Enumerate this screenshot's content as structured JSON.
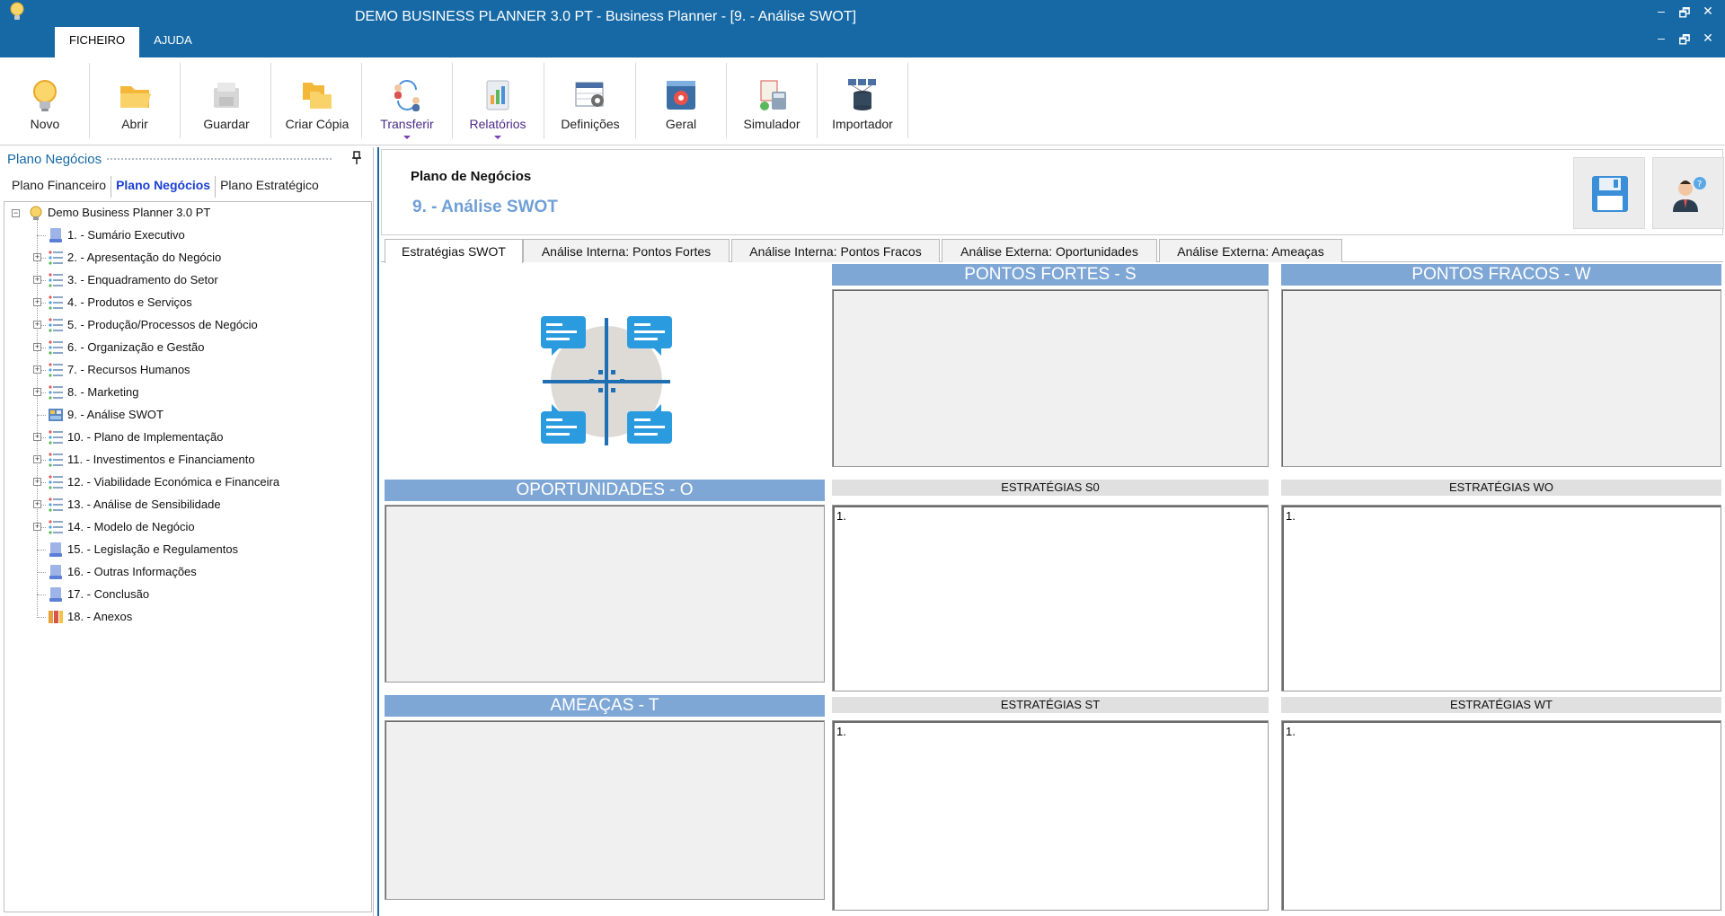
{
  "window": {
    "title": "DEMO BUSINESS PLANNER 3.0 PT - Business Planner - [9. - Análise SWOT]",
    "controls": {
      "minimize": "–",
      "restore": "🗗",
      "close": "✕"
    }
  },
  "menu": {
    "tabs": [
      "FICHEIRO",
      "AJUDA"
    ],
    "active": "FICHEIRO"
  },
  "ribbon": {
    "buttons": [
      {
        "label": "Novo",
        "icon": "lightbulb-icon"
      },
      {
        "label": "Abrir",
        "icon": "folder-open-icon"
      },
      {
        "label": "Guardar",
        "icon": "save-disabled-icon"
      },
      {
        "label": "Criar Cópia",
        "icon": "copy-folder-icon"
      },
      {
        "label": "Transferir",
        "icon": "transfer-people-icon",
        "dropdown": true
      },
      {
        "label": "Relatórios",
        "icon": "reports-chart-icon",
        "dropdown": true
      },
      {
        "label": "Definições",
        "icon": "settings-table-icon"
      },
      {
        "label": "Geral",
        "icon": "general-gear-icon"
      },
      {
        "label": "Simulador",
        "icon": "simulator-calculator-icon"
      },
      {
        "label": "Importador",
        "icon": "importer-database-icon"
      }
    ]
  },
  "left_panel": {
    "title": "Plano Negócios",
    "tabs": [
      "Plano Financeiro",
      "Plano Negócios",
      "Plano Estratégico"
    ],
    "active_tab": "Plano Negócios",
    "tree": {
      "root": "Demo Business Planner 3.0 PT",
      "items": [
        {
          "label": "1. - Sumário Executivo",
          "expandable": false,
          "icon": "page-icon"
        },
        {
          "label": "2. - Apresentação do Negócio",
          "expandable": true,
          "icon": "list-icon"
        },
        {
          "label": "3. - Enquadramento do Setor",
          "expandable": true,
          "icon": "list-icon"
        },
        {
          "label": "4. - Produtos e Serviços",
          "expandable": true,
          "icon": "list-icon"
        },
        {
          "label": "5. - Produção/Processos de Negócio",
          "expandable": true,
          "icon": "list-icon"
        },
        {
          "label": "6. - Organização e Gestão",
          "expandable": true,
          "icon": "list-icon"
        },
        {
          "label": "7. - Recursos Humanos",
          "expandable": true,
          "icon": "list-icon"
        },
        {
          "label": "8. - Marketing",
          "expandable": true,
          "icon": "list-icon"
        },
        {
          "label": "9. - Análise SWOT",
          "expandable": false,
          "icon": "swot-icon"
        },
        {
          "label": "10. - Plano de Implementação",
          "expandable": true,
          "icon": "list-icon"
        },
        {
          "label": "11. - Investimentos e Financiamento",
          "expandable": true,
          "icon": "list-icon"
        },
        {
          "label": "12. - Viabilidade Económica e Financeira",
          "expandable": true,
          "icon": "list-icon"
        },
        {
          "label": "13. - Análise de Sensibilidade",
          "expandable": true,
          "icon": "list-icon"
        },
        {
          "label": "14. - Modelo de Negócio",
          "expandable": true,
          "icon": "list-icon"
        },
        {
          "label": "15. - Legislação e Regulamentos",
          "expandable": false,
          "icon": "page-icon"
        },
        {
          "label": "16. - Outras Informações",
          "expandable": false,
          "icon": "page-icon"
        },
        {
          "label": "17. - Conclusão",
          "expandable": false,
          "icon": "page-icon"
        },
        {
          "label": "18. - Anexos",
          "expandable": false,
          "icon": "attachments-icon"
        }
      ]
    }
  },
  "document": {
    "title": "Plano de Negócios",
    "subtitle": "9. - Análise SWOT",
    "tabs": [
      "Estratégias SWOT",
      "Análise Interna: Pontos Fortes",
      "Análise Interna: Pontos Fracos",
      "Análise Externa: Oportunidades",
      "Análise Externa: Ameaças"
    ],
    "active_tab": "Estratégias SWOT",
    "swot": {
      "strengths": "PONTOS FORTES - S",
      "weaknesses": "PONTOS FRACOS - W",
      "opportunities": "OPORTUNIDADES - O",
      "threats": "AMEAÇAS - T",
      "so_label": "ESTRATÉGIAS S0",
      "wo_label": "ESTRATÉGIAS WO",
      "st_label": "ESTRATÉGIAS ST",
      "wt_label": "ESTRATÉGIAS WT",
      "so_text": "1.",
      "wo_text": "1.",
      "st_text": "1.",
      "wt_text": "1."
    }
  },
  "colors": {
    "titlebar": "#1669a5",
    "section_header": "#7ea7d6",
    "subtitle": "#6f9fd6",
    "active_left_tab": "#1a3fd4"
  }
}
